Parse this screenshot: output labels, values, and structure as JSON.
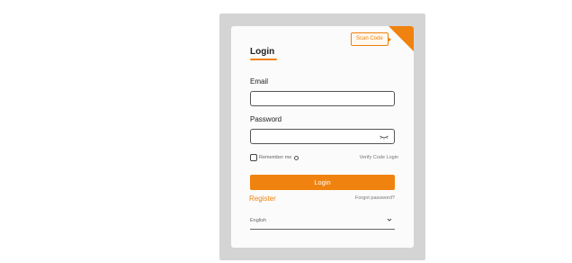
{
  "scan_code_label": "Scan Code",
  "title": "Login",
  "email": {
    "label": "Email",
    "value": "",
    "placeholder": ""
  },
  "password": {
    "label": "Password",
    "value": "",
    "placeholder": ""
  },
  "remember_label": "Remember me",
  "verify_code_label": "Verify Code Login",
  "login_button": "Login",
  "register_link": "Register",
  "forgot_link": "Forgot password?",
  "language": {
    "selected": "English"
  },
  "icons": {
    "corner": "qr-corner-icon",
    "password_toggle": "eye-closed-icon",
    "info": "info-icon",
    "language_dropdown": "chevron-down-icon"
  },
  "colors": {
    "accent": "#f0820f",
    "frame": "#d4d4d4",
    "card": "#fbfbfb"
  }
}
